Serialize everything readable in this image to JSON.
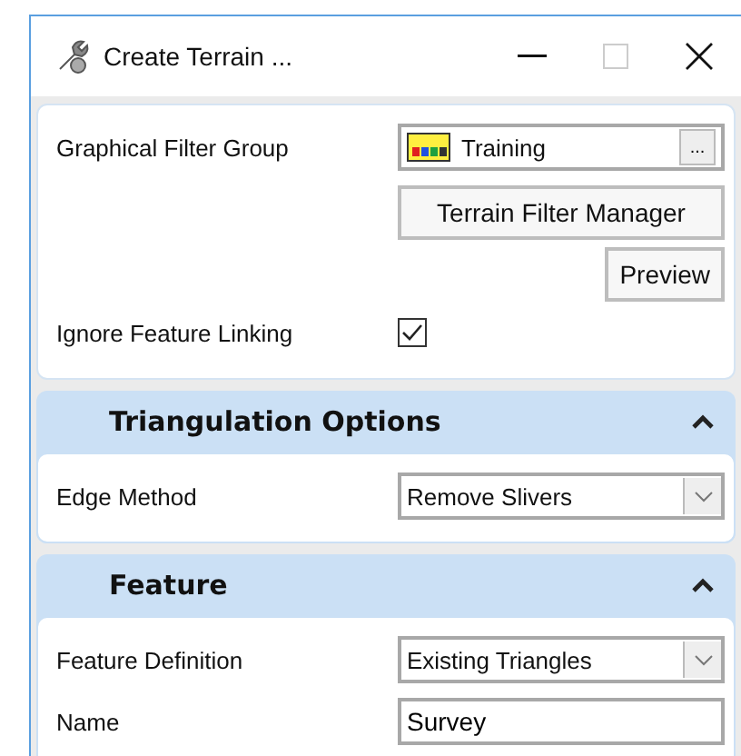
{
  "window": {
    "title": "Create Terrain ..."
  },
  "filter": {
    "label": "Graphical Filter Group",
    "value": "Training",
    "browse": "...",
    "manager_button": "Terrain Filter Manager",
    "preview_button": "Preview"
  },
  "ignore_linking": {
    "label": "Ignore Feature Linking",
    "checked": true
  },
  "sections": [
    {
      "title": "Triangulation Options",
      "expanded": true,
      "rows": [
        {
          "kind": "dropdown",
          "label": "Edge Method",
          "value": "Remove Slivers"
        }
      ]
    },
    {
      "title": "Feature",
      "expanded": true,
      "rows": [
        {
          "kind": "dropdown",
          "label": "Feature Definition",
          "value": "Existing Triangles"
        },
        {
          "kind": "text",
          "label": "Name",
          "value": "Survey"
        }
      ]
    }
  ]
}
